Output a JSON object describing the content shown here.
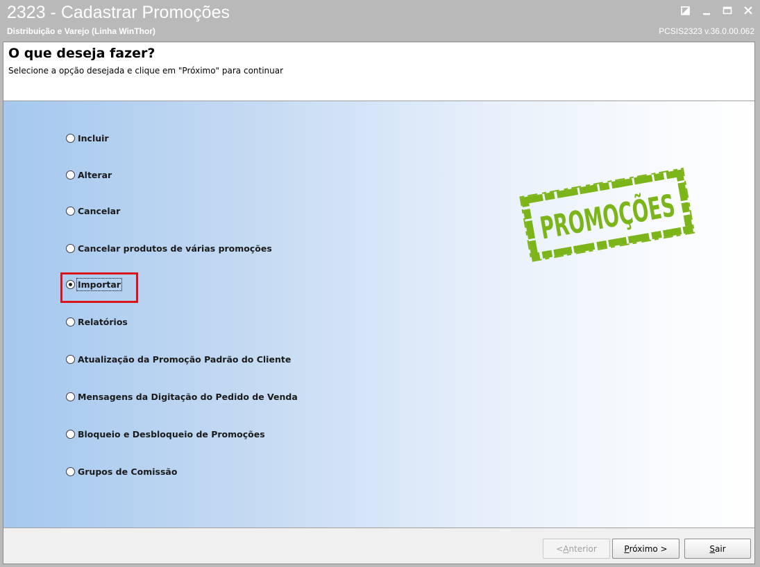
{
  "window": {
    "title": "2323 - Cadastrar Promoções",
    "subtitle": "Distribuição e Varejo (Linha WinThor)",
    "version": "PCSIS2323  v.36.0.00.062"
  },
  "header": {
    "title": "O que deseja fazer?",
    "instruction": "Selecione a opção desejada e clique em \"Próximo\" para continuar"
  },
  "options": [
    {
      "label": "Incluir",
      "checked": false
    },
    {
      "label": "Alterar",
      "checked": false
    },
    {
      "label": "Cancelar",
      "checked": false
    },
    {
      "label": "Cancelar produtos de várias promoções",
      "checked": false
    },
    {
      "label": "Importar",
      "checked": true
    },
    {
      "label": "Relatórios",
      "checked": false
    },
    {
      "label": "Atualização da Promoção Padrão do Cliente",
      "checked": false
    },
    {
      "label": "Mensagens da Digitação do Pedido de Venda",
      "checked": false
    },
    {
      "label": "Bloqueio e Desbloqueio de Promoções",
      "checked": false
    },
    {
      "label": "Grupos de Comissão",
      "checked": false
    }
  ],
  "stamp": {
    "text": "PROMOÇÕES",
    "color": "#7cb51a"
  },
  "footer": {
    "back_prefix": "< ",
    "back_access": "A",
    "back_rest": "nterior",
    "next_access": "P",
    "next_rest": "róximo >",
    "exit_access": "S",
    "exit_rest": "air"
  },
  "colors": {
    "highlight": "#d9141b",
    "titlebar": "#b9b9b9"
  }
}
